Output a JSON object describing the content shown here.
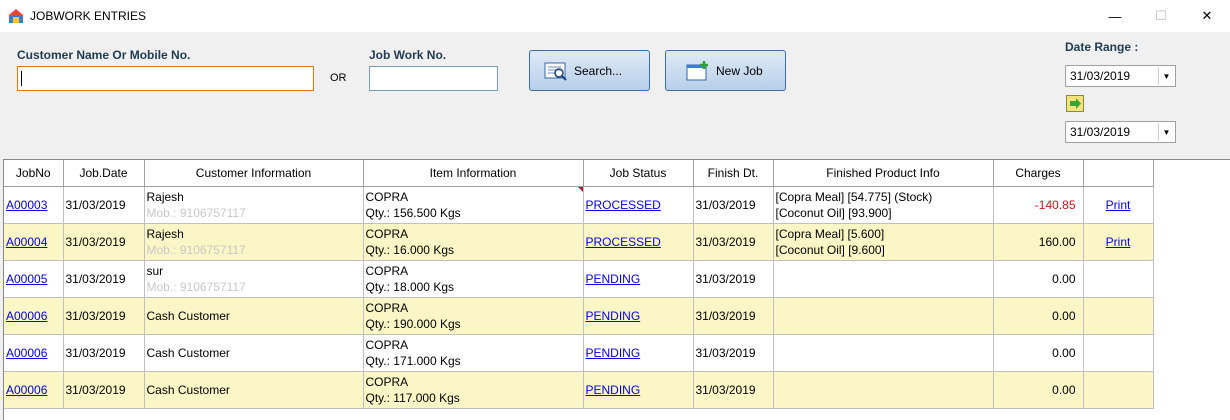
{
  "window": {
    "title": "JOBWORK ENTRIES",
    "min": "—",
    "max": "☐",
    "close": "✕"
  },
  "search": {
    "customer_label": "Customer Name Or Mobile No.",
    "customer_value": "",
    "or_text": "OR",
    "jobno_label": "Job Work No.",
    "jobno_value": "",
    "search_button": "Search...",
    "new_job_button": "New Job"
  },
  "date_range": {
    "label": "Date Range :",
    "from": "31/03/2019",
    "to": "31/03/2019"
  },
  "table": {
    "columns": [
      "JobNo",
      "Job.Date",
      "Customer Information",
      "Item Information",
      "Job Status",
      "Finish Dt.",
      "Finished Product Info",
      "Charges",
      ""
    ],
    "rows": [
      {
        "jobno": "A00003",
        "date": "31/03/2019",
        "cust1": "Rajesh",
        "cust2": "Mob.: 9106757117",
        "item1": "COPRA",
        "item2": "Qty.: 156.500 Kgs",
        "status": "PROCESSED",
        "finish": "31/03/2019",
        "prod1": "[Copra Meal] [54.775] (Stock)",
        "prod2": "[Coconut Oil] [93.900]",
        "charges": "-140.85",
        "action": "Print",
        "negative": true
      },
      {
        "jobno": "A00004",
        "date": "31/03/2019",
        "cust1": "Rajesh",
        "cust2": "Mob.: 9106757117",
        "item1": "COPRA",
        "item2": "Qty.: 16.000 Kgs",
        "status": "PROCESSED",
        "finish": "31/03/2019",
        "prod1": "[Copra Meal] [5.600]",
        "prod2": "[Coconut Oil] [9.600]",
        "charges": "160.00",
        "action": "Print",
        "negative": false
      },
      {
        "jobno": "A00005",
        "date": "31/03/2019",
        "cust1": "sur",
        "cust2": "Mob.: 9106757117",
        "item1": "COPRA",
        "item2": "Qty.: 18.000 Kgs",
        "status": "PENDING",
        "finish": "31/03/2019",
        "prod1": "",
        "prod2": "",
        "charges": "0.00",
        "action": "",
        "negative": false
      },
      {
        "jobno": "A00006",
        "date": "31/03/2019",
        "cust1": "Cash Customer",
        "cust2": "",
        "item1": "COPRA",
        "item2": "Qty.: 190.000 Kgs",
        "status": "PENDING",
        "finish": "31/03/2019",
        "prod1": "",
        "prod2": "",
        "charges": "0.00",
        "action": "",
        "negative": false
      },
      {
        "jobno": "A00006",
        "date": "31/03/2019",
        "cust1": "Cash Customer",
        "cust2": "",
        "item1": "COPRA",
        "item2": "Qty.: 171.000 Kgs",
        "status": "PENDING",
        "finish": "31/03/2019",
        "prod1": "",
        "prod2": "",
        "charges": "0.00",
        "action": "",
        "negative": false
      },
      {
        "jobno": "A00006",
        "date": "31/03/2019",
        "cust1": "Cash Customer",
        "cust2": "",
        "item1": "COPRA",
        "item2": "Qty.: 117.000 Kgs",
        "status": "PENDING",
        "finish": "31/03/2019",
        "prod1": "",
        "prod2": "",
        "charges": "0.00",
        "action": "",
        "negative": false
      }
    ]
  },
  "colors": {
    "row_alt": "#fbf6c5",
    "link": "#0000ee",
    "negative": "#d01414",
    "focus_border": "#e07a10"
  }
}
